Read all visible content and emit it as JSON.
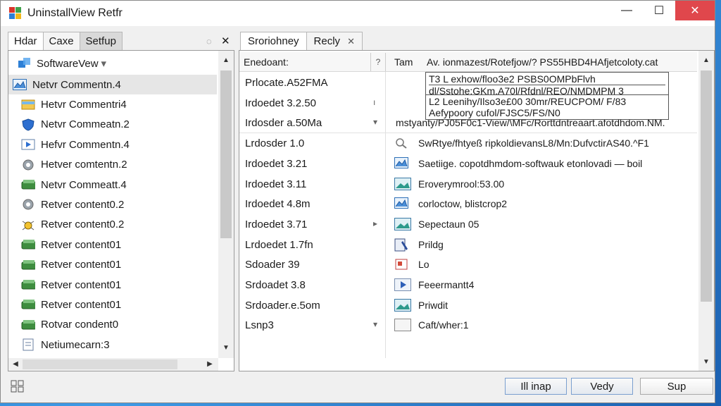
{
  "window": {
    "title": "UninstallView Retfr"
  },
  "titlebar": {
    "minimize": "—",
    "maximize": "☐",
    "close": "✕"
  },
  "left_tabs": [
    {
      "label": "Hdar"
    },
    {
      "label": "Caxe"
    },
    {
      "label": "Setfup"
    }
  ],
  "left_tab_icons": {
    "pin": "◌",
    "close": "✕"
  },
  "software_dropdown": {
    "label": "SoftwareVew",
    "arrow": "▾"
  },
  "left_list": [
    {
      "label": "Netvr Commentn.4",
      "icon": "chart-icon",
      "selected": true
    },
    {
      "label": "Hetvr Commentri4",
      "icon": "folder-icon"
    },
    {
      "label": "Netvr Commeatn.2",
      "icon": "shield-icon"
    },
    {
      "label": "Hefvr Commentn.4",
      "icon": "window-icon"
    },
    {
      "label": "Hetver comtentn.2",
      "icon": "gear-icon"
    },
    {
      "label": "Netvr Commeatt.4",
      "icon": "package-icon"
    },
    {
      "label": "Retver content0.2",
      "icon": "gear-icon"
    },
    {
      "label": "Retver content0.2",
      "icon": "bug-icon"
    },
    {
      "label": "Retver content01",
      "icon": "package-icon"
    },
    {
      "label": "Retver content01",
      "icon": "package-icon"
    },
    {
      "label": "Retver content01",
      "icon": "package-icon"
    },
    {
      "label": "Retver content01",
      "icon": "package-icon"
    },
    {
      "label": "Rotvar condent0",
      "icon": "package-icon"
    },
    {
      "label": "Netiumecarn:3",
      "icon": "document-icon"
    }
  ],
  "right_tabs": [
    {
      "label": "Sroriohney"
    },
    {
      "label": "Recly"
    }
  ],
  "right_tab_close": "✕",
  "table": {
    "headers": [
      "Enedoant:",
      "?",
      "Tam",
      "Av. ionmazest/Rotefjow/? PS55HBD4HAfjetcoloty.cat"
    ],
    "rows": [
      {
        "c1": "Prlocate.A52FMA",
        "mark": "",
        "c3": "",
        "icon": ""
      },
      {
        "c1": "Irdoedet 3.2.50",
        "mark": "ı",
        "c3": "",
        "icon": ""
      },
      {
        "c1": "Irdosder a.50Ma",
        "mark": "▾",
        "c3": "mstyanty/PJ05F0c1-View/\\MFc/Rorttdntreaart.afotdhdom.NM.",
        "icon": ""
      },
      {
        "c1": "Lrdosder 1.0",
        "mark": "",
        "c3": "SwRtye/fhtyeß ripkoldievansL8/Mn:DufvctirAS40.^F1",
        "icon": "search-icon"
      },
      {
        "c1": "Irdoedet 3.21",
        "mark": "",
        "c3": "Saetiige. copotdhmdom-softwauk etonlovadi — boil",
        "icon": "chart-icon"
      },
      {
        "c1": "Irdoedet 3.11",
        "mark": "",
        "c3": "Eroverymrool:53.00",
        "icon": "landscape-icon"
      },
      {
        "c1": "Irdoedet 4.8m",
        "mark": "",
        "c3": "corloctow, blistcrop2",
        "icon": "chart-icon"
      },
      {
        "c1": "Irdoedet 3.71",
        "mark": "▸",
        "c3": "Sepectaun         05",
        "icon": "landscape-icon"
      },
      {
        "c1": "Lrdoedet 1.7fn",
        "mark": "",
        "c3": "Prildg",
        "icon": "pen-icon"
      },
      {
        "c1": "Sdoader 39",
        "mark": "",
        "c3": "Lo",
        "icon": "app-icon"
      },
      {
        "c1": "Srdoadet 3.8",
        "mark": "",
        "c3": "Feeermantt4",
        "icon": "play-icon"
      },
      {
        "c1": "Srdoader.e.5om",
        "mark": "",
        "c3": "Priwdit",
        "icon": "landscape-icon"
      },
      {
        "c1": "Lsnp3",
        "mark": "▾",
        "c3": "Caft/wher:1",
        "icon": "blank-icon"
      }
    ]
  },
  "popups": [
    {
      "lines": [
        "T3 L exhow/floo3e2 PSBS0OMPbFlvh",
        "dl/Sstohe:GKm.A70l/Rfdnl/REO/NMDMPM 3"
      ]
    },
    {
      "lines": [
        "L2 Leenihy/Ilso3e£00 30mr/REUCPOM/ F/83",
        "Aefypoory cufol/FJSC5/FS/N0"
      ]
    }
  ],
  "buttons": {
    "b1": "Ill inap",
    "b2": "Vedy",
    "b3": "Sup"
  },
  "status_icon": "grid-icon"
}
